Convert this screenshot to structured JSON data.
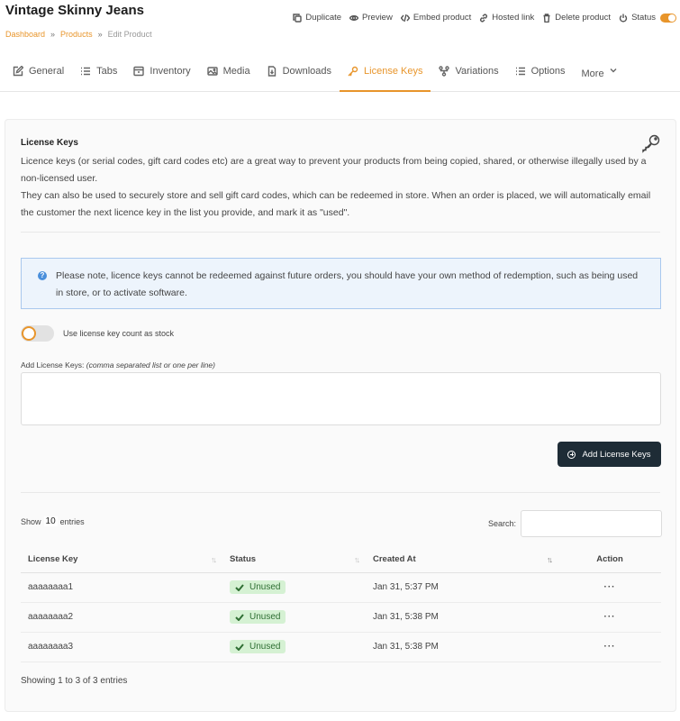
{
  "header": {
    "title": "Vintage Skinny Jeans",
    "breadcrumb": [
      "Dashboard",
      "Products",
      "Edit Product"
    ],
    "breadcrumb_sep": "»",
    "actions": {
      "duplicate": "Duplicate",
      "preview": "Preview",
      "embed": "Embed product",
      "hosted": "Hosted link",
      "delete": "Delete product",
      "status": "Status"
    }
  },
  "tabs": {
    "general": "General",
    "tabs": "Tabs",
    "inventory": "Inventory",
    "media": "Media",
    "downloads": "Downloads",
    "license": "License Keys",
    "variations": "Variations",
    "options": "Options",
    "more": "More"
  },
  "license": {
    "title": "License Keys",
    "desc1": "Licence keys (or serial codes, gift card codes etc) are a great way to prevent your products from being copied, shared, or otherwise illegally used by a non-licensed user.",
    "desc2": "They can also be used to securely store and sell gift card codes, which can be redeemed in store. When an order is placed, we will automatically email the customer the next licence key in the list you provide, and mark it as \"used\".",
    "notice": "Please note, licence keys cannot be redeemed against future orders, you should have your own method of redemption, such as being used in store, or to activate software.",
    "toggle_label": "Use license key count as stock",
    "keys_label": "Add License Keys:",
    "keys_hint": "(comma separated list or one per line)",
    "add_button": "Add License Keys"
  },
  "table": {
    "show": "Show",
    "entries_count": "10",
    "entries": "entries",
    "search_label": "Search:",
    "columns": [
      "License Key",
      "Status",
      "Created At",
      "Action"
    ],
    "rows": [
      {
        "key": "aaaaaaaa1",
        "status": "Unused",
        "created": "Jan 31, 5:37 PM",
        "action": "···"
      },
      {
        "key": "aaaaaaaa2",
        "status": "Unused",
        "created": "Jan 31, 5:38 PM",
        "action": "···"
      },
      {
        "key": "aaaaaaaa3",
        "status": "Unused",
        "created": "Jan 31, 5:38 PM",
        "action": "···"
      }
    ],
    "info": "Showing 1 to 3 of 3 entries"
  },
  "colors": {
    "accent": "#e8952b",
    "dark_button": "#1e2c36",
    "badge_bg": "#d5f1d3",
    "notice_bg": "#edf4fc"
  }
}
